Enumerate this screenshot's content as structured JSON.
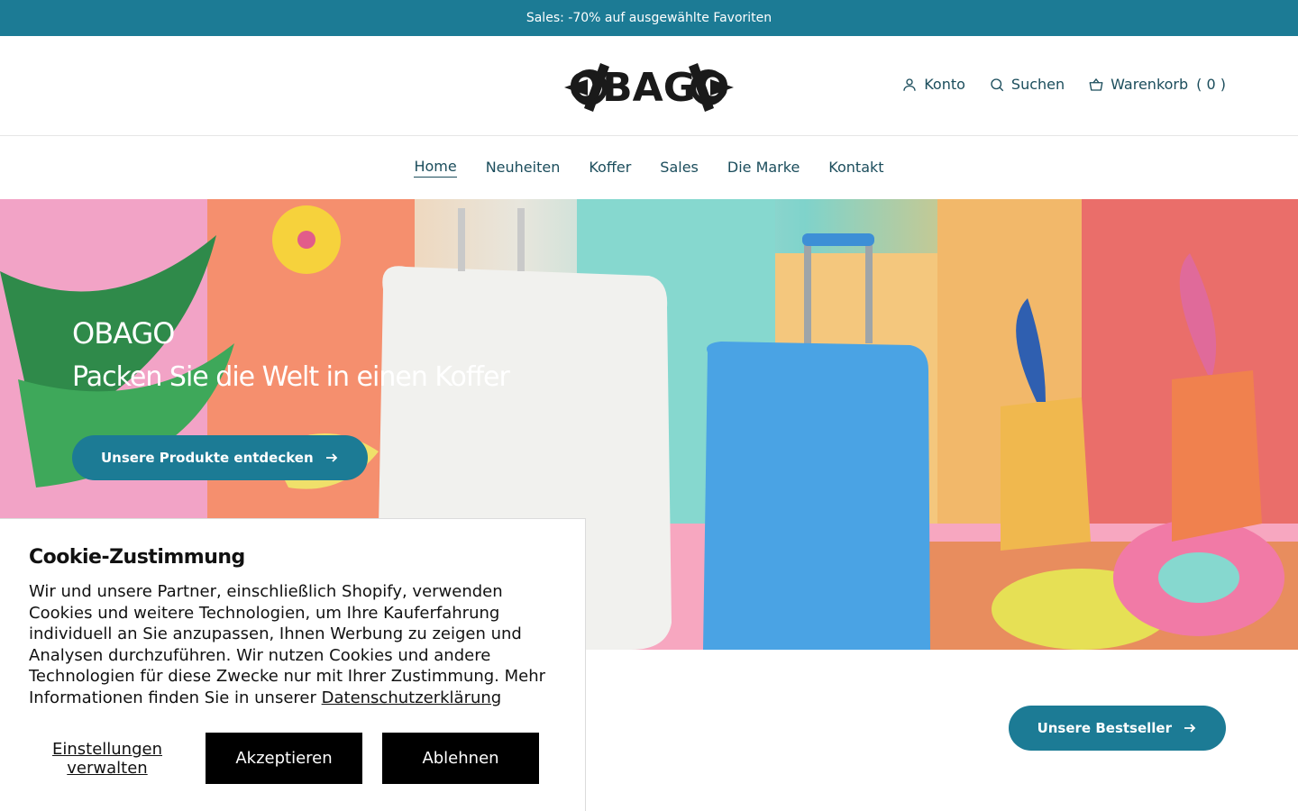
{
  "announcement": {
    "text": "Sales: -70% auf ausgewählte Favoriten"
  },
  "logo": {
    "text": "OBAGO"
  },
  "header": {
    "account_label": "Konto",
    "search_label": "Suchen",
    "cart_label": "Warenkorb",
    "cart_count": "( 0 )"
  },
  "nav": [
    {
      "label": "Home",
      "active": true
    },
    {
      "label": "Neuheiten"
    },
    {
      "label": "Koffer"
    },
    {
      "label": "Sales"
    },
    {
      "label": "Die Marke"
    },
    {
      "label": "Kontakt"
    }
  ],
  "hero": {
    "title": "OBAGO",
    "subtitle": "Packen Sie die Welt in einen Koffer",
    "cta_label": "Unsere Produkte entdecken"
  },
  "bestsellers": {
    "cta_label": "Unsere Bestseller"
  },
  "cookie": {
    "title": "Cookie-Zustimmung",
    "text": "Wir und unsere Partner, einschließlich Shopify, verwenden Cookies und weitere Technologien, um Ihre Kauferfahrung individuell an Sie anzupassen, Ihnen Werbung zu zeigen und Analysen durchzuführen. Wir nutzen Cookies und andere Technologien für diese Zwecke nur mit Ihrer Zustimmung. Mehr Informationen finden Sie in unserer",
    "privacy_link": "Datenschutzerklärung",
    "manage_label": "Einstellungen verwalten",
    "accept_label": "Akzeptieren",
    "decline_label": "Ablehnen"
  },
  "colors": {
    "accent": "#1c7b95",
    "text": "#1b4d5c"
  }
}
